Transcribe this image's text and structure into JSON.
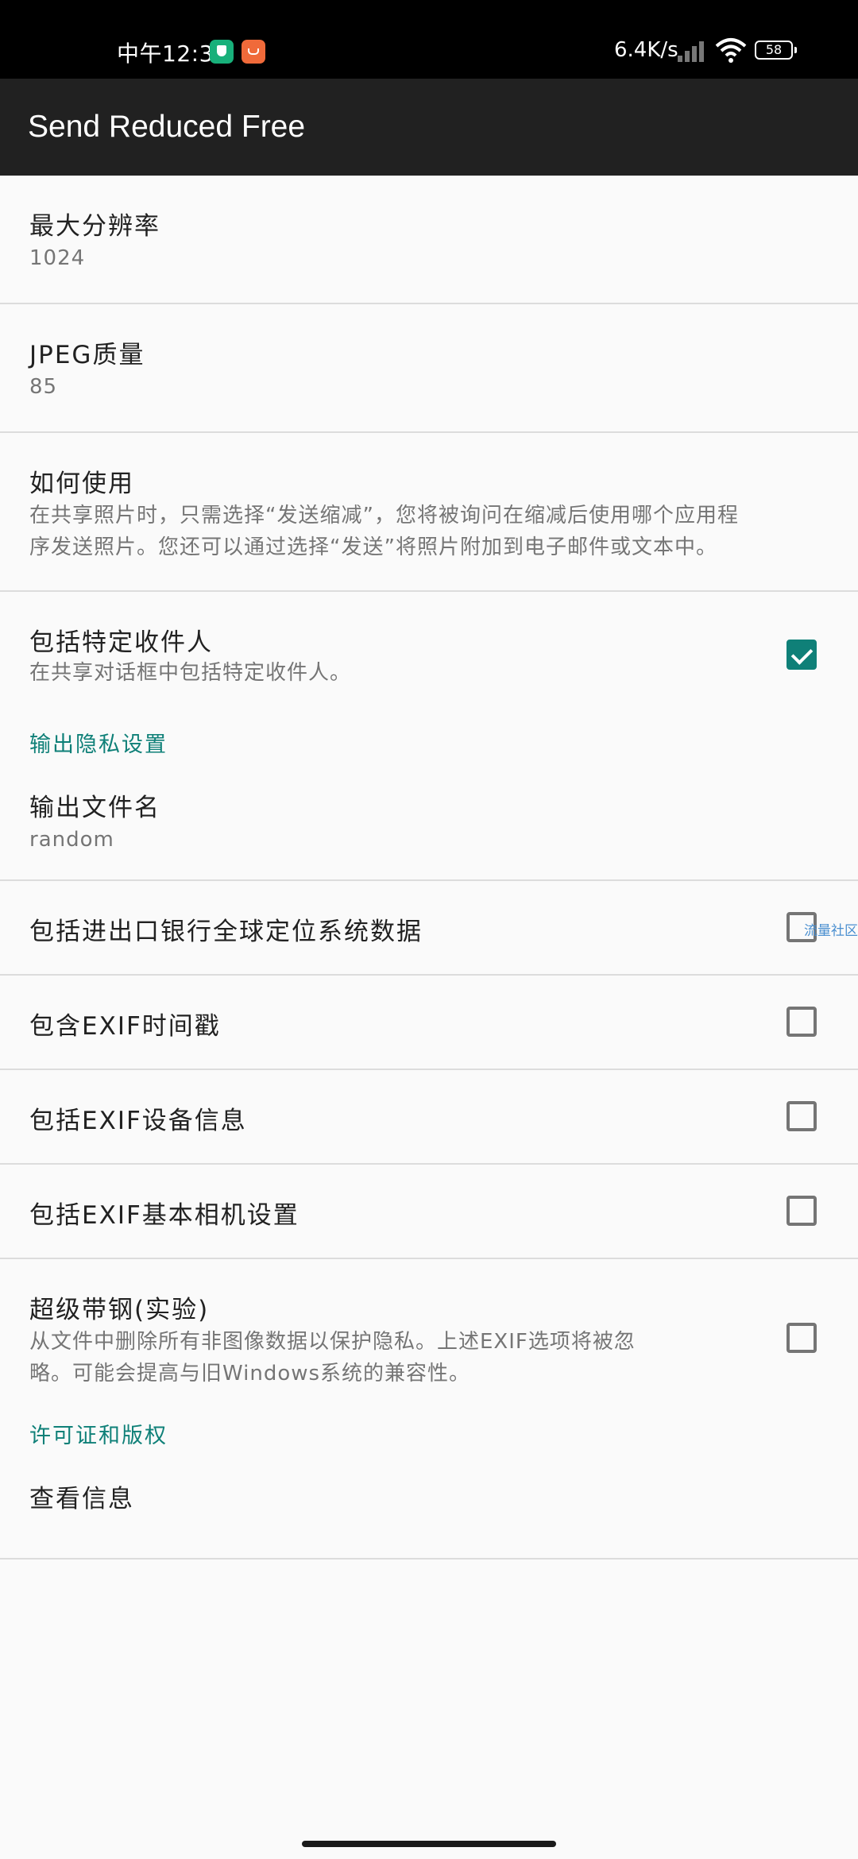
{
  "status_bar": {
    "time": "中午12:31",
    "net_speed": "6.4K/s",
    "battery": "58"
  },
  "app_bar": {
    "title": "Send Reduced Free"
  },
  "prefs": {
    "max_resolution": {
      "title": "最大分辨率",
      "summary": "1024"
    },
    "jpeg_quality": {
      "title": "JPEG质量",
      "summary": "85"
    },
    "how_to_use": {
      "title": "如何使用",
      "summary_line1": "在共享照片时，只需选择“发送缩减”，您将被询问在缩减后使用哪个应用程",
      "summary_line2": "序发送照片。您还可以通过选择“发送”将照片附加到电子邮件或文本中。"
    },
    "include_recipients": {
      "title": "包括特定收件人",
      "summary": "在共享对话框中包括特定收件人。",
      "checked": true
    }
  },
  "privacy": {
    "category": "输出隐私设置",
    "output_filename": {
      "title": "输出文件名",
      "summary": "random"
    },
    "include_gps": {
      "title": "包括进出口银行全球定位系统数据",
      "checked": false
    },
    "include_exif_time": {
      "title": "包含EXIF时间戳",
      "checked": false
    },
    "include_exif_device": {
      "title": "包括EXIF设备信息",
      "checked": false
    },
    "include_exif_camera": {
      "title": "包括EXIF基本相机设置",
      "checked": false
    },
    "super_strip": {
      "title": "超级带钢(实验)",
      "summary_line1": "从文件中删除所有非图像数据以保护隐私。上述EXIF选项将被忽",
      "summary_line2": "略。可能会提高与旧Windows系统的兼容性。",
      "checked": false
    }
  },
  "license": {
    "category": "许可证和版权",
    "view_info": {
      "title": "查看信息"
    }
  },
  "watermark": "流量社区",
  "colors": {
    "accent": "#0f8078",
    "app_bar": "#212121",
    "background": "#fafafa"
  }
}
